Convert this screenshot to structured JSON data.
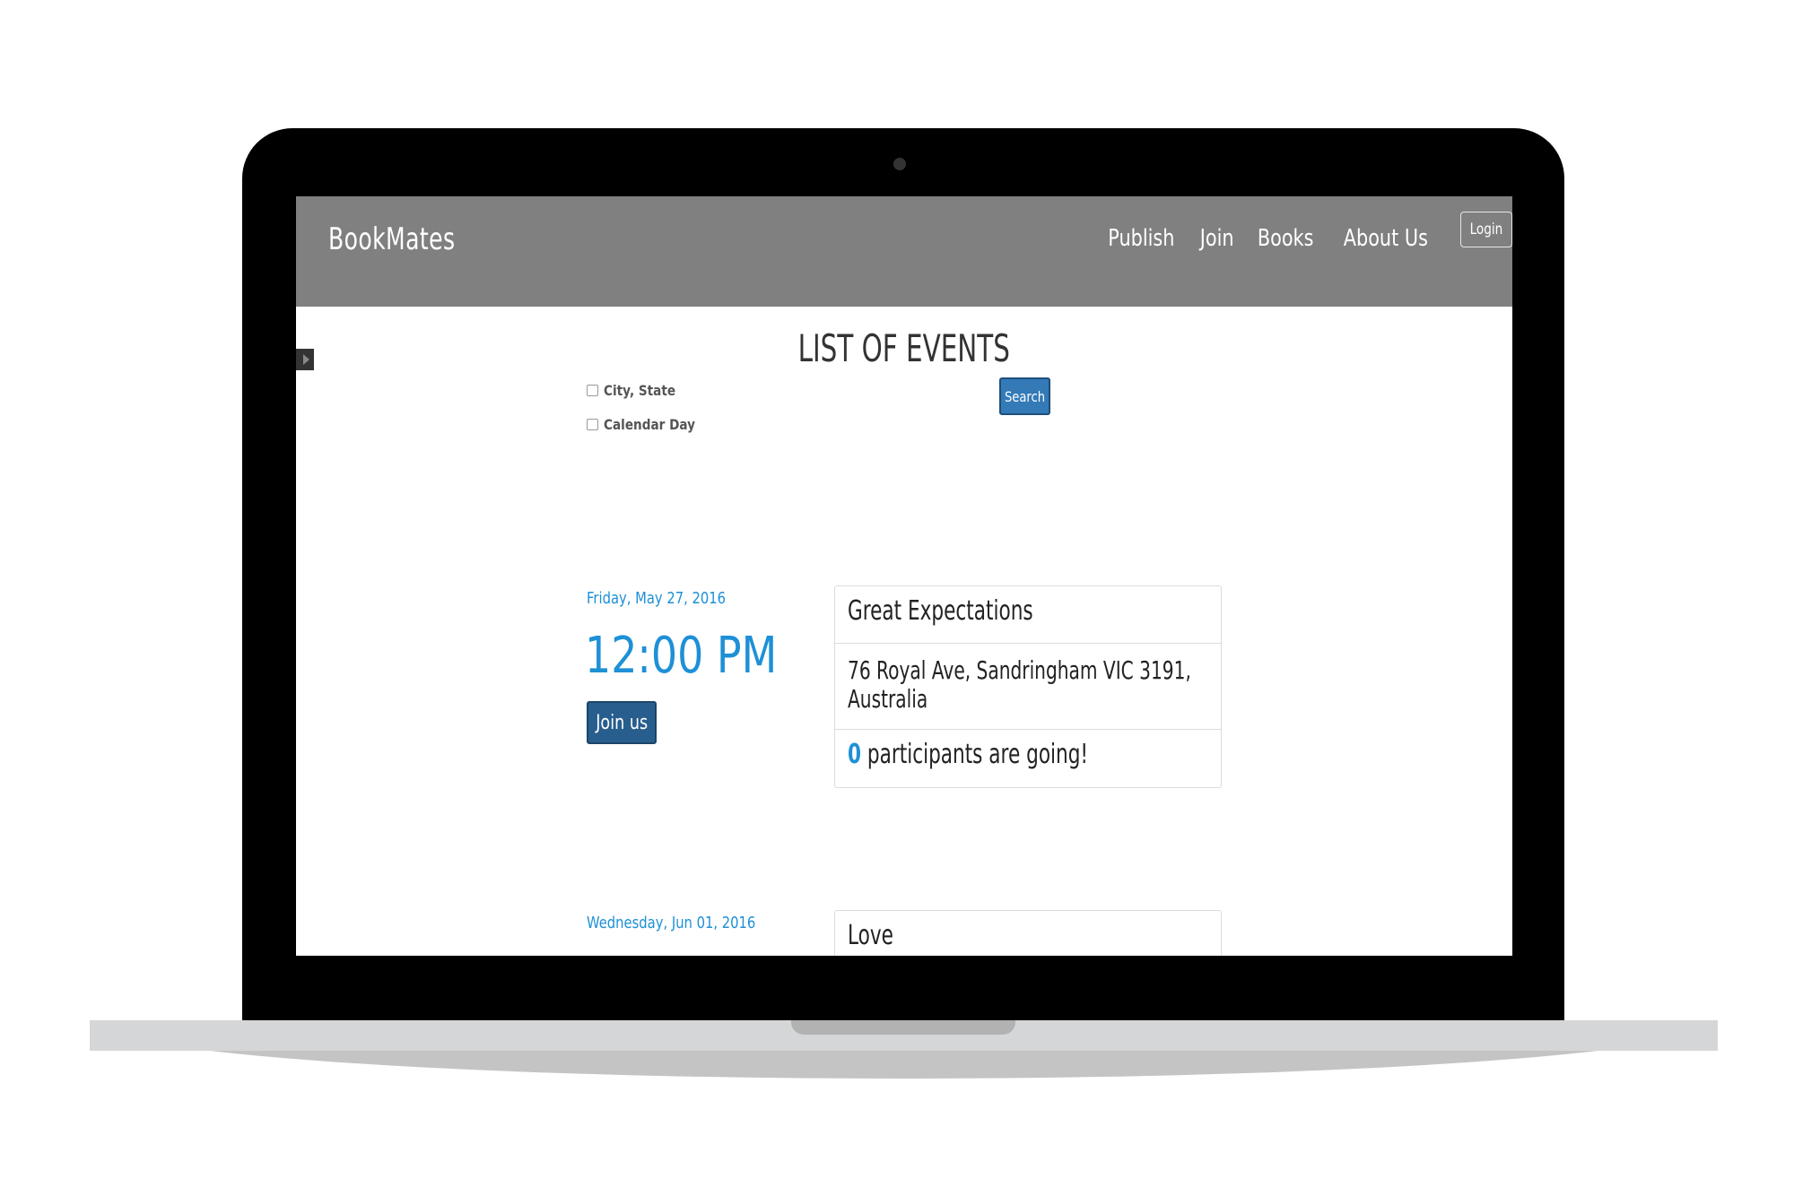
{
  "navbar": {
    "brand": "BookMates",
    "links": [
      "Publish",
      "Join",
      "Books",
      "About Us"
    ],
    "login": "Login"
  },
  "page": {
    "title": "LIST OF EVENTS"
  },
  "filters": {
    "city_state": "City, State",
    "calendar_day": "Calendar Day",
    "search_label": "Search"
  },
  "events": [
    {
      "date": "Friday, May 27, 2016",
      "time": "12:00 PM",
      "join_label": "Join us",
      "title": "Great Expectations",
      "address_line1": "76 Royal Ave, Sandringham VIC 3191,",
      "address_line2": "Australia",
      "participants": "0",
      "participants_text": "participants are going!"
    },
    {
      "date": "Wednesday, Jun 01, 2016",
      "title": "Love"
    }
  ],
  "colors": {
    "navbar": "#808080",
    "accent": "#1e90d6",
    "button": "#337ab7"
  }
}
